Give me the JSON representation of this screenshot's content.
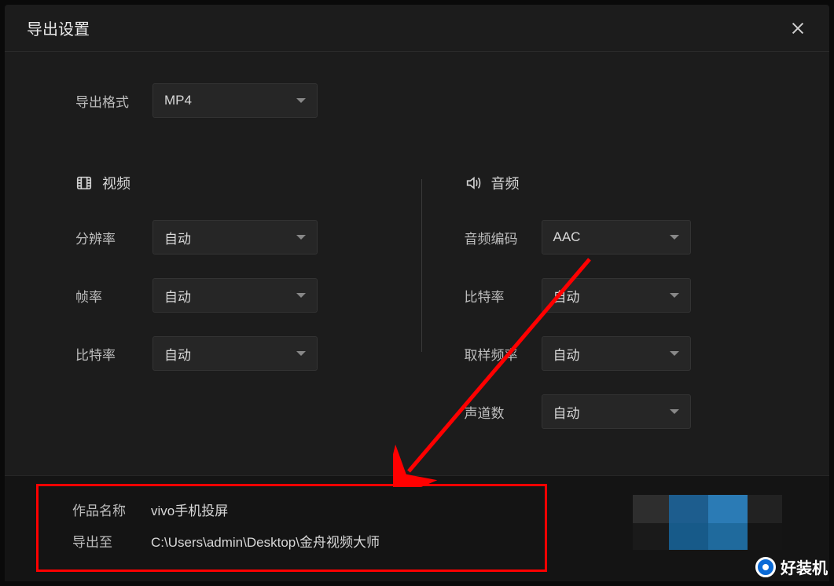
{
  "dialog_title": "导出设置",
  "export_format": {
    "label": "导出格式",
    "value": "MP4"
  },
  "video_section": {
    "heading": "视频",
    "resolution": {
      "label": "分辨率",
      "value": "自动"
    },
    "framerate": {
      "label": "帧率",
      "value": "自动"
    },
    "bitrate": {
      "label": "比特率",
      "value": "自动"
    }
  },
  "audio_section": {
    "heading": "音频",
    "codec": {
      "label": "音频编码",
      "value": "AAC"
    },
    "bitrate": {
      "label": "比特率",
      "value": "自动"
    },
    "samplerate": {
      "label": "取样频率",
      "value": "自动"
    },
    "channels": {
      "label": "声道数",
      "value": "自动"
    }
  },
  "footer": {
    "name_label": "作品名称",
    "name_value": "vivo手机投屏",
    "path_label": "导出至",
    "path_value": "C:\\Users\\admin\\Desktop\\金舟视频大师"
  },
  "watermark_text": "好装机"
}
